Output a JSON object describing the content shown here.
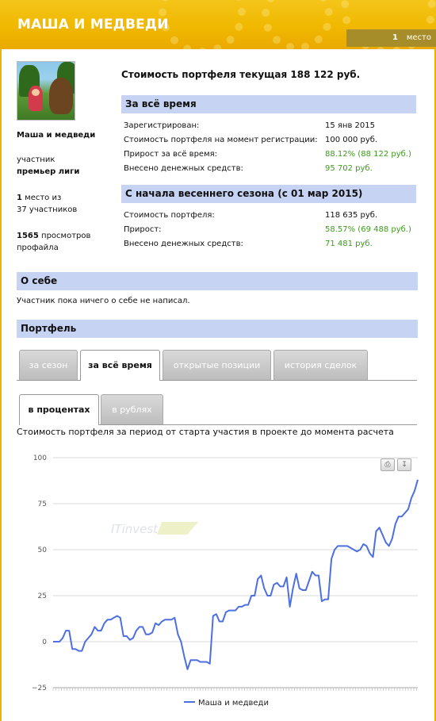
{
  "header": {
    "title": "МАША И МЕДВЕДИ",
    "rank_number": "1",
    "rank_word": "место"
  },
  "profile": {
    "name": "Маша и медведи",
    "role": "участник",
    "league": "премьер лиги",
    "place_number": "1",
    "place_text": "место из",
    "participants": "37 участников",
    "views_number": "1565",
    "views_text": "просмотров",
    "views_text2": "профайла"
  },
  "portfolio_value": "Стоимость портфеля текущая 188 122 руб.",
  "all_time": {
    "title": "За всё время",
    "rows": [
      {
        "label": "Зарегистрирован:",
        "value": "15 янв 2015",
        "green": false
      },
      {
        "label": "Стоимость портфеля на момент регистрации:",
        "value": "100 000 руб.",
        "green": false
      },
      {
        "label": "Прирост за всё время:",
        "value": "88.12% (88 122 руб.)",
        "green": true
      },
      {
        "label": "Внесено денежных средств:",
        "value": "95 702 руб.",
        "green": true
      }
    ]
  },
  "season": {
    "title": "С начала весеннего сезона (с 01 мар 2015)",
    "rows": [
      {
        "label": "Стоимость портфеля:",
        "value": "118 635 руб.",
        "green": false
      },
      {
        "label": "Прирост:",
        "value": "58.57% (69 488 руб.)",
        "green": true
      },
      {
        "label": "Внесено денежных средств:",
        "value": "71 481 руб.",
        "green": true
      }
    ]
  },
  "about": {
    "title": "О себе",
    "text": "Участник пока ничего о себе не написал."
  },
  "portfolio": {
    "title": "Портфель",
    "tabs": [
      "за сезон",
      "за всё время",
      "открытые позиции",
      "история сделок"
    ],
    "active_tab": 1,
    "subtabs": [
      "в процентах",
      "в рублях"
    ],
    "active_subtab": 0,
    "caption": "Стоимость портфеля за период от старта участия в проекте до момента расчета"
  },
  "watermark": "ITinvest",
  "toolbar": {
    "print_icon": "print-icon",
    "download_icon": "download-icon"
  },
  "colors": {
    "header": "#f0b800",
    "section": "#c7d3f3",
    "line": "#4d6fe0",
    "positive": "#3e9a1e"
  },
  "chart_data": {
    "type": "line",
    "y_ticks": [
      "100",
      "75",
      "50",
      "25",
      "0",
      "−25"
    ],
    "ylim": [
      -25,
      100
    ],
    "grid": true,
    "legend_position": "bottom",
    "series": [
      {
        "name": "Маша и медведи",
        "values": [
          0,
          0,
          0,
          2,
          6,
          6,
          -4,
          -4,
          -5,
          -5,
          0,
          2,
          4,
          8,
          6,
          6,
          10,
          12,
          12,
          13,
          14,
          13,
          3,
          3,
          1,
          2,
          6,
          8,
          8,
          4,
          4,
          5,
          10,
          9,
          11,
          12,
          12,
          12,
          13,
          4,
          0,
          -8,
          -15,
          -10,
          -10,
          -10,
          -11,
          -11,
          -11,
          -12,
          14,
          15,
          11,
          11,
          16,
          17,
          17,
          17,
          19,
          19,
          20,
          20,
          25,
          25,
          34,
          36,
          29,
          25,
          25,
          31,
          32,
          30,
          30,
          35,
          19,
          29,
          37,
          29,
          28,
          28,
          33,
          38,
          36,
          36,
          22,
          23,
          23,
          45,
          50,
          52,
          52,
          52,
          52,
          51,
          50,
          49,
          50,
          53,
          52,
          48,
          46,
          60,
          62,
          58,
          54,
          52,
          56,
          64,
          68,
          68,
          70,
          72,
          78,
          82,
          88
        ]
      }
    ]
  }
}
